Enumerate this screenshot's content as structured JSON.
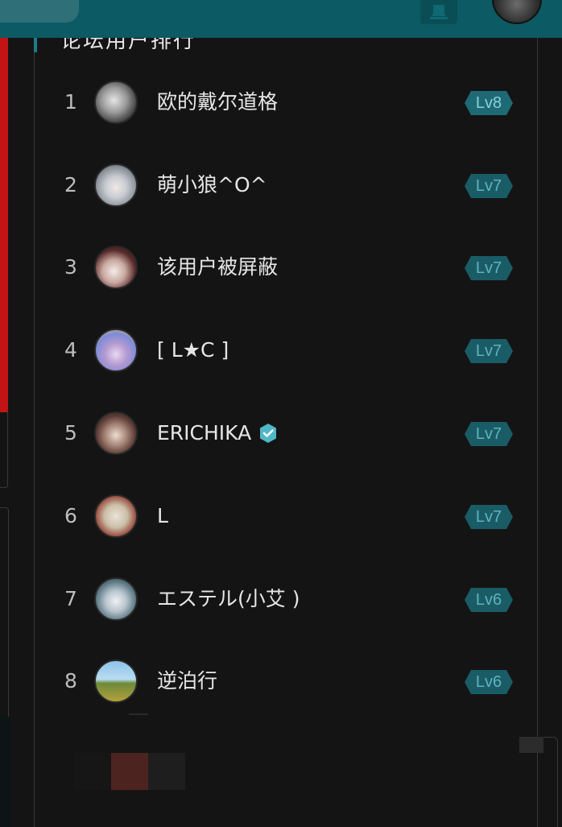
{
  "panel": {
    "title": "论坛用户排行"
  },
  "ranking": [
    {
      "rank": "1",
      "name": "欧的戴尔道格",
      "level": "Lv8",
      "avatar": "gray-chibi-avatar",
      "verified": false
    },
    {
      "rank": "2",
      "name": "萌小狼^O^",
      "level": "Lv7",
      "avatar": "silver-hair-girl-avatar",
      "verified": false
    },
    {
      "rank": "3",
      "name": "该用户被屏蔽",
      "level": "Lv7",
      "avatar": "hat-girl-avatar",
      "verified": false
    },
    {
      "rank": "4",
      "name": "[ L★C ]",
      "level": "Lv7",
      "avatar": "sunflower-girl-avatar",
      "verified": false
    },
    {
      "rank": "5",
      "name": "ERICHIKA",
      "level": "Lv7",
      "avatar": "brown-hair-girl-avatar",
      "verified": true
    },
    {
      "rank": "6",
      "name": "L",
      "level": "Lv7",
      "avatar": "gothic-l-letter-avatar",
      "verified": false
    },
    {
      "rank": "7",
      "name": "エステル(小艾 )",
      "level": "Lv6",
      "avatar": "white-hair-girl-avatar",
      "verified": false
    },
    {
      "rank": "8",
      "name": "逆泊行",
      "level": "Lv6",
      "avatar": "landscape-field-avatar",
      "verified": false
    }
  ],
  "colors": {
    "header": "#0c5a63",
    "badge_bg": "#1a5c66",
    "badge_text": "#5fb3bd",
    "verified": "#4fb7c6",
    "left_strip": "#c21414"
  },
  "icons": {
    "header": [
      "search-icon",
      "bell-icon",
      "user-avatar-icon"
    ],
    "verified": "verified-check-icon"
  }
}
